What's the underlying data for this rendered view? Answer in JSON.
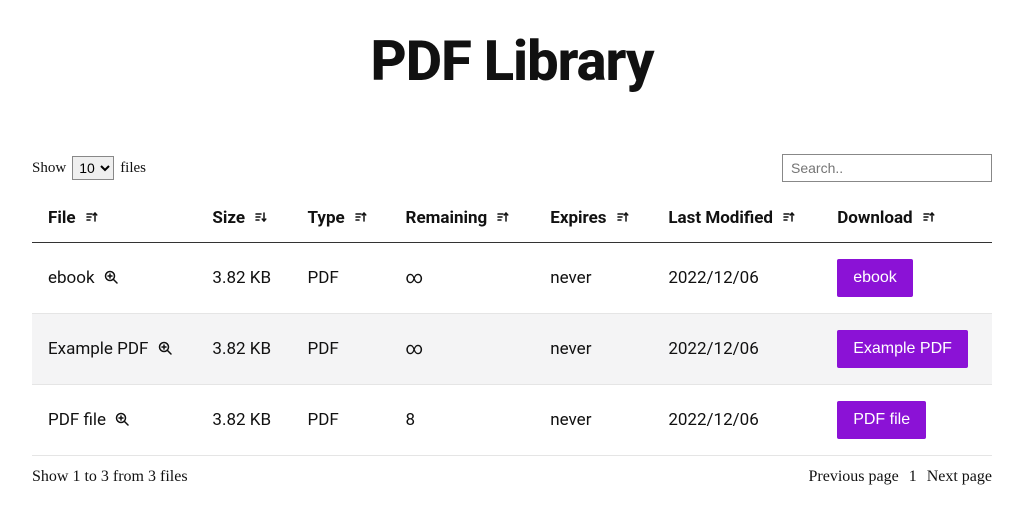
{
  "page": {
    "title": "PDF Library"
  },
  "controls": {
    "show_label_pre": "Show",
    "show_label_post": "files",
    "page_size_value": "10",
    "search_placeholder": "Search.."
  },
  "table": {
    "headers": {
      "file": "File",
      "size": "Size",
      "type": "Type",
      "remaining": "Remaining",
      "expires": "Expires",
      "last_modified": "Last Modified",
      "download": "Download"
    },
    "rows": [
      {
        "file": "ebook",
        "size": "3.82 KB",
        "type": "PDF",
        "remaining": "∞",
        "expires": "never",
        "last_modified": "2022/12/06",
        "download": "ebook"
      },
      {
        "file": "Example PDF",
        "size": "3.82 KB",
        "type": "PDF",
        "remaining": "∞",
        "expires": "never",
        "last_modified": "2022/12/06",
        "download": "Example PDF"
      },
      {
        "file": "PDF file",
        "size": "3.82 KB",
        "type": "PDF",
        "remaining": "8",
        "expires": "never",
        "last_modified": "2022/12/06",
        "download": "PDF file"
      }
    ]
  },
  "footer": {
    "status": "Show 1 to 3 from 3 files",
    "prev": "Previous page",
    "page": "1",
    "next": "Next page"
  },
  "colors": {
    "accent": "#8b12d6"
  }
}
